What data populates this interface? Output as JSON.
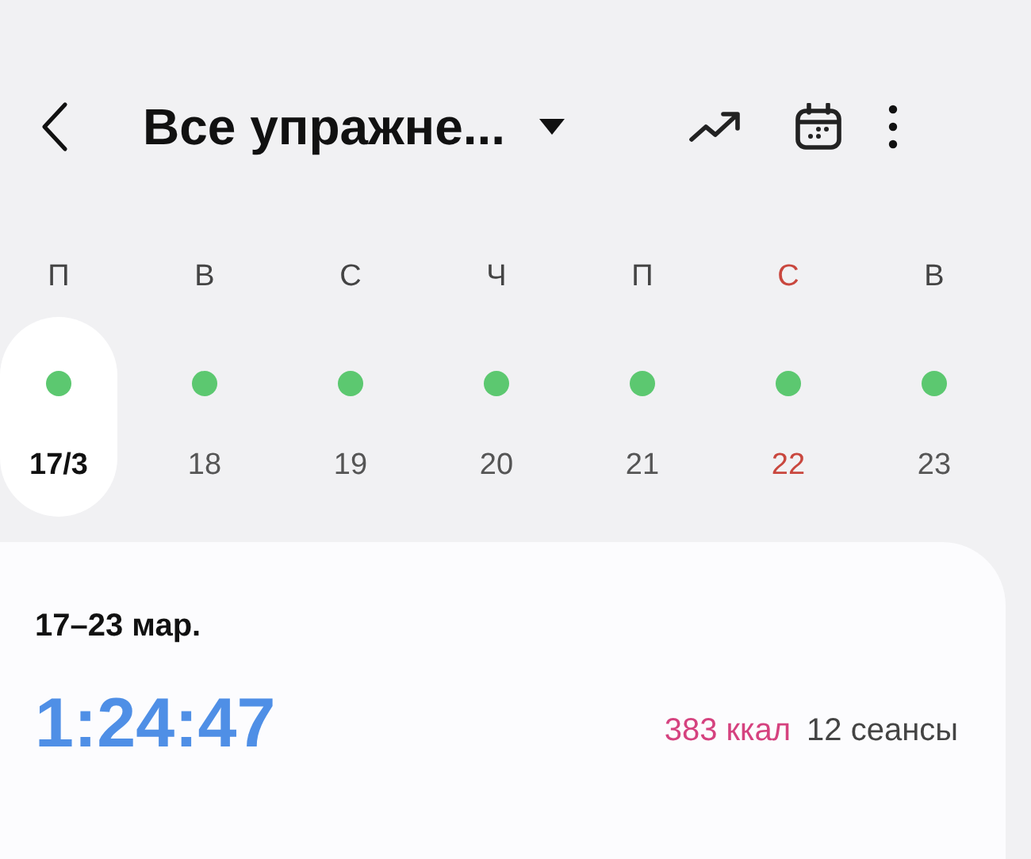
{
  "header": {
    "title": "Все упражне..."
  },
  "days": [
    {
      "weekday": "П",
      "date": "17/3",
      "selected": true,
      "weekend": false,
      "activity": true
    },
    {
      "weekday": "В",
      "date": "18",
      "selected": false,
      "weekend": false,
      "activity": true
    },
    {
      "weekday": "С",
      "date": "19",
      "selected": false,
      "weekend": false,
      "activity": true
    },
    {
      "weekday": "Ч",
      "date": "20",
      "selected": false,
      "weekend": false,
      "activity": true
    },
    {
      "weekday": "П",
      "date": "21",
      "selected": false,
      "weekend": false,
      "activity": true
    },
    {
      "weekday": "С",
      "date": "22",
      "selected": false,
      "weekend": true,
      "activity": true
    },
    {
      "weekday": "В",
      "date": "23",
      "selected": false,
      "weekend": false,
      "activity": true
    }
  ],
  "summary": {
    "range": "17–23 мар.",
    "duration": "1:24:47",
    "calories": "383 ккал",
    "sessions": "12 сеансы"
  }
}
